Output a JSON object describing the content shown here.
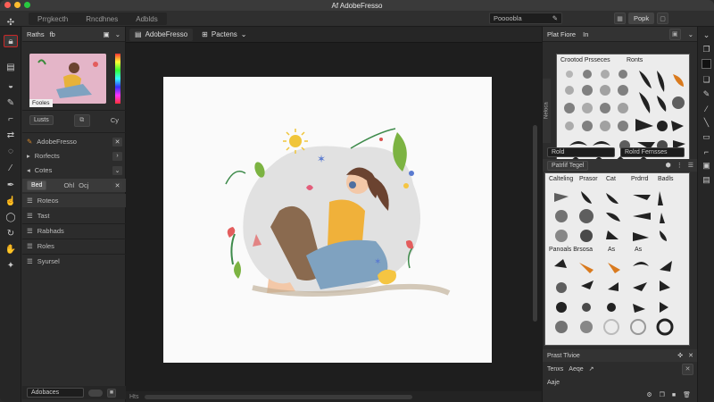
{
  "window": {
    "title": "Af AdobeFresso"
  },
  "menu": {
    "tabs": [
      "Prrgkecth",
      "Rncdhnes",
      "Adblds"
    ],
    "search_value": "Poooobla",
    "share_label": "Popk"
  },
  "left_panel": {
    "header_title": "Raths",
    "header_tab": "fb",
    "thumb_label": "Fooles",
    "controls": {
      "label1": "Lusts",
      "label2": "Cy"
    },
    "layers": [
      {
        "label": "AdobeFresso",
        "icon": "brush-icon"
      },
      {
        "label": "Rorfects",
        "icon": "triangle-icon"
      },
      {
        "label": "Cotes",
        "icon": "triangle-icon"
      }
    ],
    "blend": {
      "mode": "Bed",
      "opt1": "Ohl",
      "opt2": "Ocj"
    },
    "layer_group_label": "Roteos",
    "sublayers": [
      "Tast",
      "Rabhads",
      "Roles",
      "Syursel"
    ],
    "bottom_label": "Adobaces"
  },
  "document": {
    "tab_title": "AdobeFresso",
    "tab_menu": "Pactens",
    "scroll_label": "Hts"
  },
  "right_panel": {
    "header_title": "Plat Fiore",
    "header_tab": "In",
    "brush_title_left": "Crootod Prsseces",
    "brush_title_right": "Ronts",
    "side_label": "Neloca",
    "field_label": "Rold",
    "field_value": "Rolrd Fernsses",
    "section_title": "Patrlif Tegel",
    "brush_cols": [
      "Calteling",
      "Prasor",
      "Cat",
      "Prdrrd",
      "Badls"
    ],
    "brush_cols_2": [
      "Panoals Brsosa",
      "As",
      "As"
    ],
    "footer_title": "Prast Tlvioe",
    "footer_row1_a": "Tenxs",
    "footer_row1_b": "Aeqe",
    "footer_row2": "Aaje"
  },
  "colors": {
    "accent": "#c92828",
    "panel": "#2c2c2c",
    "canvas": "#1e1e1e",
    "paper": "#fafafa"
  }
}
